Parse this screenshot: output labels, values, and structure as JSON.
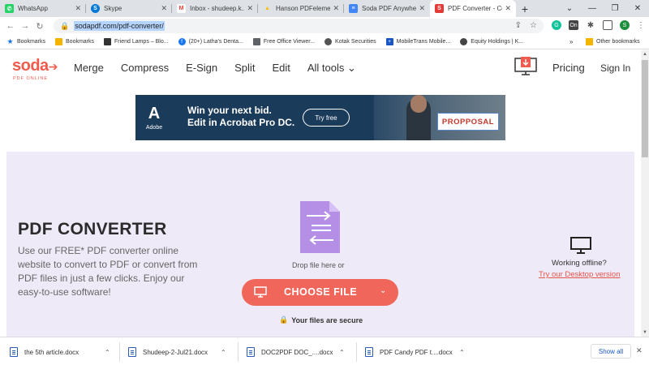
{
  "browser": {
    "tabs": [
      {
        "title": "WhatsApp",
        "fav_color": "#25d366",
        "fav_glyph": "✆"
      },
      {
        "title": "Skype",
        "fav_color": "#0078d4",
        "fav_glyph": "S"
      },
      {
        "title": "Inbox - shudeep.k...",
        "fav_color": "#ea4335",
        "fav_glyph": "M"
      },
      {
        "title": "Hanson PDFeleme...",
        "fav_color": "#fbbc04",
        "fav_glyph": "▲"
      },
      {
        "title": "Soda PDF Anywher...",
        "fav_color": "#4285f4",
        "fav_glyph": "≡"
      },
      {
        "title": "PDF Converter - Co...",
        "fav_color": "#e53935",
        "fav_glyph": "S"
      }
    ],
    "new_tab": "+",
    "window_controls": [
      "⌄",
      "—",
      "❐",
      "✕"
    ],
    "url": "sodapdf.com/pdf-converter/",
    "profile_initial": "S",
    "bookmarks": [
      {
        "label": "Bookmarks",
        "icon": "star-icon",
        "color": "#1a73e8"
      },
      {
        "label": "Bookmarks",
        "icon": "folder-icon",
        "color": "#f4b400"
      },
      {
        "label": "Friend Lamps – Blo...",
        "icon": "lamp-icon",
        "color": "#333333"
      },
      {
        "label": "(20+) Latha's Denta...",
        "icon": "facebook-icon",
        "color": "#1877f2"
      },
      {
        "label": "Free Office Viewer...",
        "icon": "office-icon",
        "color": "#5f6368"
      },
      {
        "label": "Kotak Securities",
        "icon": "kotak-icon",
        "color": "#555555"
      },
      {
        "label": "MobileTrans Mobile...",
        "icon": "plus-icon",
        "color": "#1a56c4"
      },
      {
        "label": "Equity Holdings | K...",
        "icon": "equity-icon",
        "color": "#444444"
      }
    ],
    "bookmarks_more": "»",
    "other_bookmarks": "Other bookmarks"
  },
  "site": {
    "logo_main": "soda",
    "logo_sub": "PDF ONLINE",
    "nav": [
      "Merge",
      "Compress",
      "E-Sign",
      "Split",
      "Edit",
      "All tools ⌄"
    ],
    "pricing": "Pricing",
    "signin": "Sign In"
  },
  "ad": {
    "brand": "Adobe",
    "line1": "Win your next bid.",
    "line2": "Edit in Acrobat Pro DC.",
    "cta": "Try free",
    "proposal": "PROPPOSAL"
  },
  "hero": {
    "title": "PDF CONVERTER",
    "description": "Use our FREE* PDF converter online website to convert to PDF or convert from PDF files in just a few clicks. Enjoy our easy-to-use software!",
    "drop_text": "Drop file here or",
    "choose_label": "CHOOSE FILE",
    "secure_text": "Your files are secure",
    "offline_text": "Working offline?",
    "offline_link": "Try our Desktop version"
  },
  "downloads": {
    "files": [
      "the 5th article.docx",
      "Shudeep-2-Jul21.docx",
      "DOC2PDF DOC_....docx",
      "PDF Candy PDF t....docx"
    ],
    "show_all": "Show all",
    "close": "✕"
  },
  "colors": {
    "accent": "#f0665a",
    "hero_bg": "#efeaf7",
    "file_icon": "#b58fe6"
  }
}
